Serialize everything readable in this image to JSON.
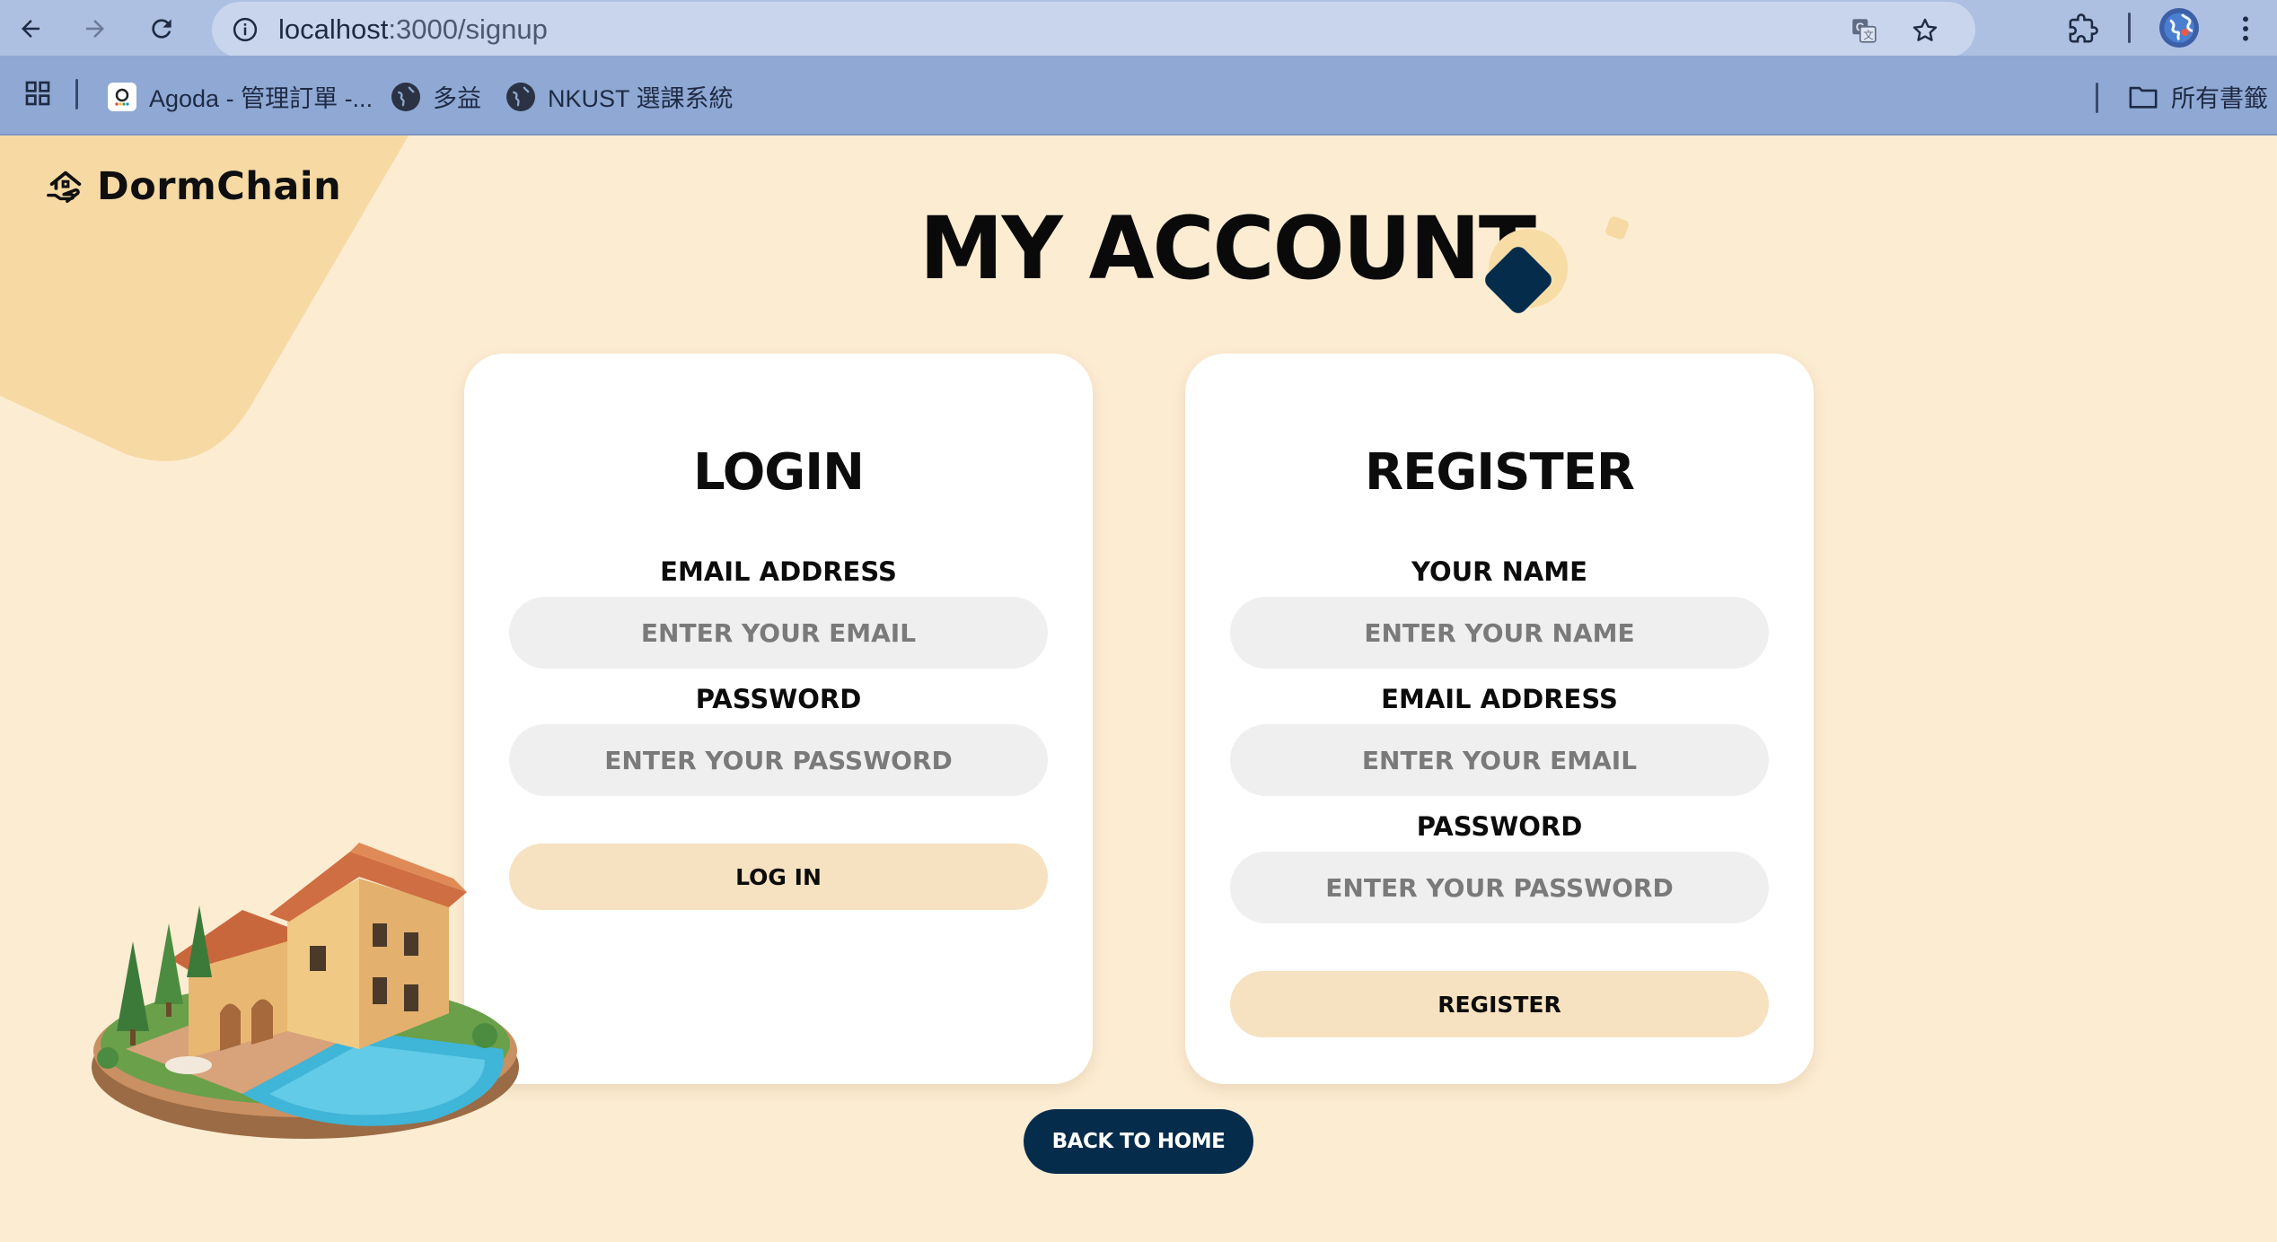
{
  "browser": {
    "url_host": "localhost",
    "url_path": ":3000/signup",
    "bookmarks": [
      {
        "label": "Agoda - 管理訂單 -..."
      },
      {
        "label": "多益"
      },
      {
        "label": "NKUST 選課系統"
      }
    ],
    "all_bookmarks_label": "所有書籤"
  },
  "brand": {
    "name": "DormChain"
  },
  "page": {
    "title": "MY ACCOUNT"
  },
  "login": {
    "title": "LOGIN",
    "email_label": "EMAIL ADDRESS",
    "email_placeholder": "ENTER YOUR EMAIL",
    "password_label": "PASSWORD",
    "password_placeholder": "ENTER YOUR PASSWORD",
    "submit_label": "LOG IN"
  },
  "register": {
    "title": "REGISTER",
    "name_label": "YOUR NAME",
    "name_placeholder": "ENTER YOUR NAME",
    "email_label": "EMAIL ADDRESS",
    "email_placeholder": "ENTER YOUR EMAIL",
    "password_label": "PASSWORD",
    "password_placeholder": "ENTER YOUR PASSWORD",
    "submit_label": "REGISTER"
  },
  "back_home_label": "BACK TO HOME",
  "colors": {
    "page_bg": "#fcecd2",
    "blob": "#f6d9a3",
    "button": "#f6e2c0",
    "input_bg": "#efefef",
    "navy": "#062c4c"
  }
}
